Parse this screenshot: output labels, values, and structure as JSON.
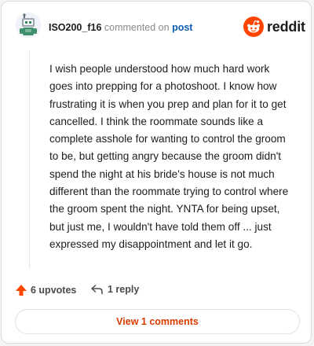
{
  "comment": {
    "username": "ISO200_f16",
    "commented_text": "commented on",
    "post_link": "post",
    "body": "I wish people understood how much hard work goes into prepping for a photoshoot. I know how frustrating it is when you prep and plan for it to get cancelled. I think the roommate sounds like a complete asshole for wanting to control the groom to be, but getting angry because the groom didn't spend the night at his bride's house is not much different than the roommate trying to control where the groom spent the night. YNTA for being upset, but just me, I wouldn't have told them off ... just expressed my disappointment and let it go."
  },
  "brand": {
    "name": "reddit",
    "color": "#ff4500",
    "icon": "reddit-logo-icon"
  },
  "actions": {
    "upvotes_label": "6 upvotes",
    "upvote_icon": "upvote-arrow-icon",
    "upvote_color": "#ff4500",
    "reply_label": "1 reply",
    "reply_icon": "reply-arrow-icon"
  },
  "footer": {
    "view_comments_label": "View 1 comments",
    "accent": "#d93a00"
  }
}
